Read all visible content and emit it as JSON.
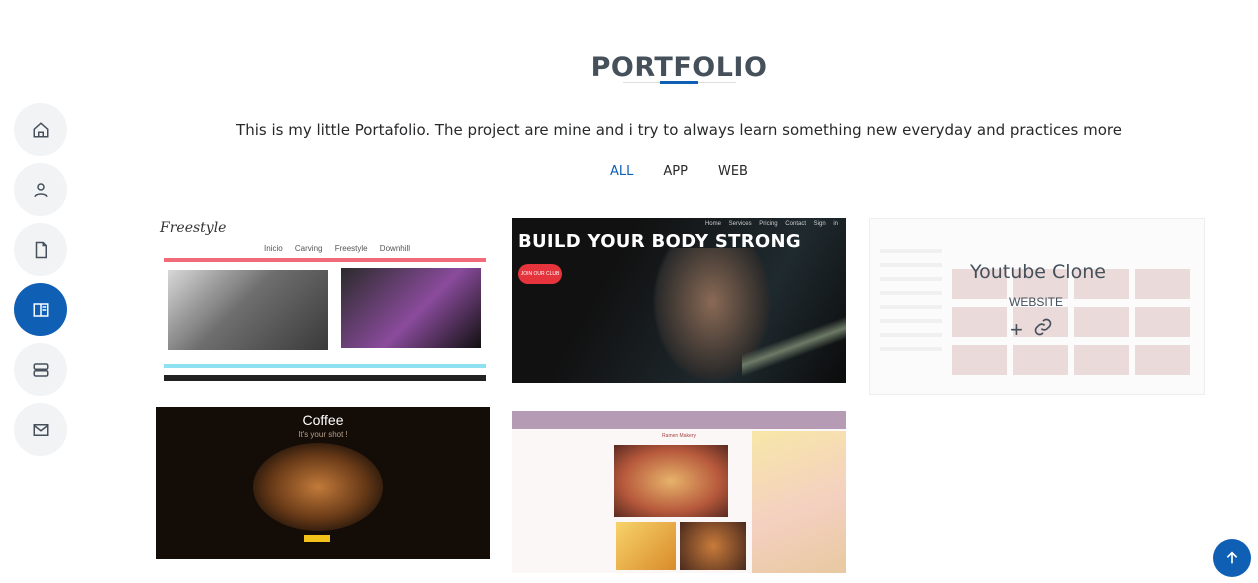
{
  "nav": {
    "items": [
      {
        "icon": "home-icon",
        "label": "Home"
      },
      {
        "icon": "person-icon",
        "label": "About"
      },
      {
        "icon": "file-icon",
        "label": "Resume"
      },
      {
        "icon": "book-icon",
        "label": "Portfolio",
        "active": true
      },
      {
        "icon": "server-icon",
        "label": "Services"
      },
      {
        "icon": "envelope-icon",
        "label": "Contact"
      }
    ]
  },
  "portfolio": {
    "title": "PORTFOLIO",
    "subtitle": "This is my little Portafolio. The project are mine and i try to always learn something new everyday and practices more",
    "filters": [
      "ALL",
      "APP",
      "WEB"
    ],
    "active_filter": "ALL",
    "cards": {
      "freestyle": {
        "logo": "Freestyle",
        "menu": "Inicio Carving Freestyle Downhill"
      },
      "gym": {
        "headline": "BUILD YOUR BODY STRONG",
        "nav": "Home Services Pricing Contact Sign in",
        "cta": "JOIN OUR CLUB"
      },
      "youtube": {
        "title": "Youtube Clone",
        "category": "WEBSITE"
      },
      "coffee": {
        "title": "Coffee",
        "subtitle": "It's your shot !"
      },
      "ramen": {
        "title": "Ramen Makery"
      }
    }
  },
  "colors": {
    "accent": "#0f5fb4"
  }
}
